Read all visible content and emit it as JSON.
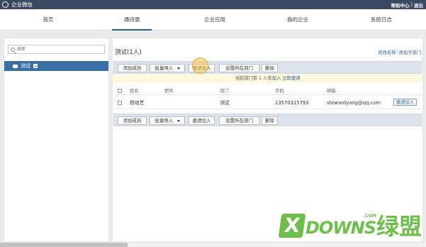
{
  "topbar": {
    "app_title": "企业微信",
    "help_label": "帮助中心",
    "separator": "|",
    "logout_label": "退出"
  },
  "nav": {
    "tabs": [
      {
        "label": "首页"
      },
      {
        "label": "通讯录"
      },
      {
        "label": "企业应用"
      },
      {
        "label": "我的企业"
      },
      {
        "label": "系统日志"
      }
    ],
    "active_index": 1
  },
  "sidebar": {
    "search_placeholder": "搜索",
    "dept_label": "测试"
  },
  "main": {
    "title": "测试(1人)",
    "edit_name_link": "修改名称",
    "link_separator": "|",
    "add_subdept_link": "添加子部门",
    "toolbar": {
      "add_member": "添加成员",
      "batch_import": "批量导入",
      "invite": "邀请加入",
      "set_dept": "设置所在部门",
      "delete": "删除"
    },
    "notice": {
      "text": "当前部门有 1 人未加入",
      "link": "立即邀请"
    },
    "table": {
      "headers": {
        "name": "姓名",
        "position": "职务",
        "department": "部门",
        "phone": "手机",
        "email": "邮箱"
      },
      "rows": [
        {
          "name": "杨培艺",
          "position": "",
          "department": "测试",
          "phone": "13570315793",
          "email": "stewardyang@qq.com",
          "action": "邀请加入"
        }
      ]
    }
  },
  "watermark": {
    "x_letter": "X",
    "text": "DOWNS",
    "com": ".COM",
    "cn": "绿盟"
  },
  "colors": {
    "topbar": "#3b4960",
    "accent": "#2c5d94",
    "selected_dept": "#3a6ea5",
    "toolbar_bg": "#dde3eb",
    "notice_bg": "#fdf7dc",
    "watermark": "#6cc04a"
  }
}
